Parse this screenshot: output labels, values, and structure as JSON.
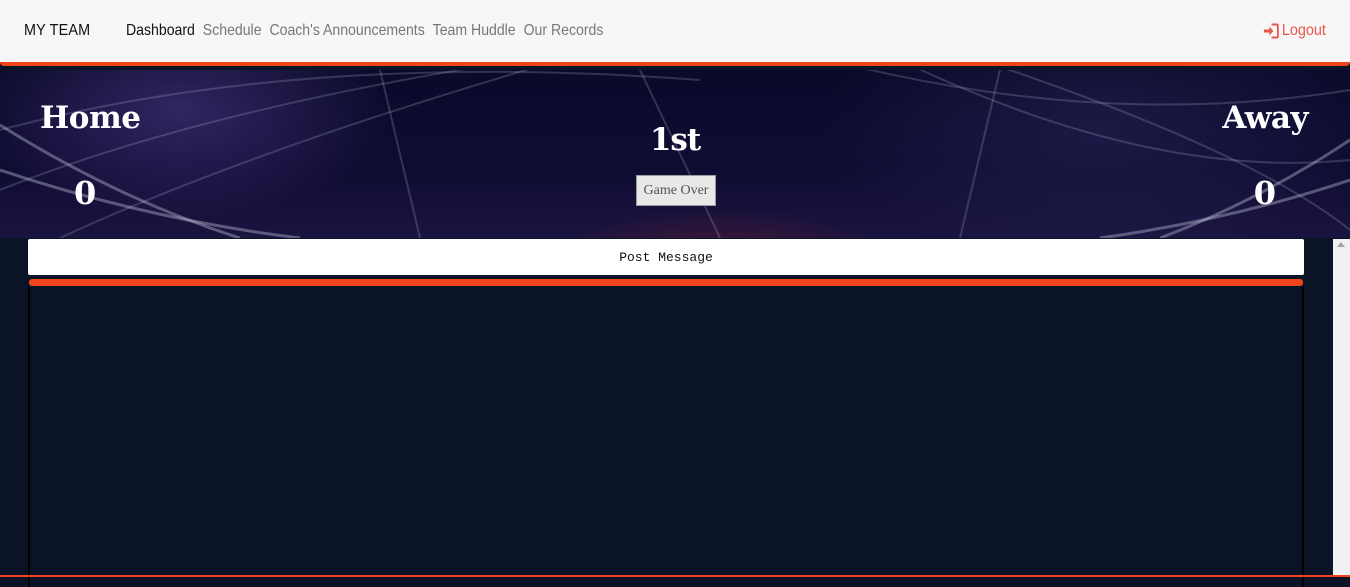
{
  "navbar": {
    "brand": "MY TEAM",
    "links": [
      {
        "label": "Dashboard",
        "active": true
      },
      {
        "label": "Schedule",
        "active": false
      },
      {
        "label": "Coach's Announcements",
        "active": false
      },
      {
        "label": "Team Huddle",
        "active": false
      },
      {
        "label": "Our Records",
        "active": false
      }
    ],
    "logout_label": "Logout",
    "logout_icon": "sign-in-icon"
  },
  "scoreboard": {
    "home_label": "Home",
    "away_label": "Away",
    "home_score": "0",
    "away_score": "0",
    "period": "1st",
    "game_over_label": "Game Over"
  },
  "messages": {
    "post_label": "Post Message"
  },
  "colors": {
    "accent": "#f0451a",
    "logout": "#e8564a",
    "panel_bg": "#0b1426"
  }
}
